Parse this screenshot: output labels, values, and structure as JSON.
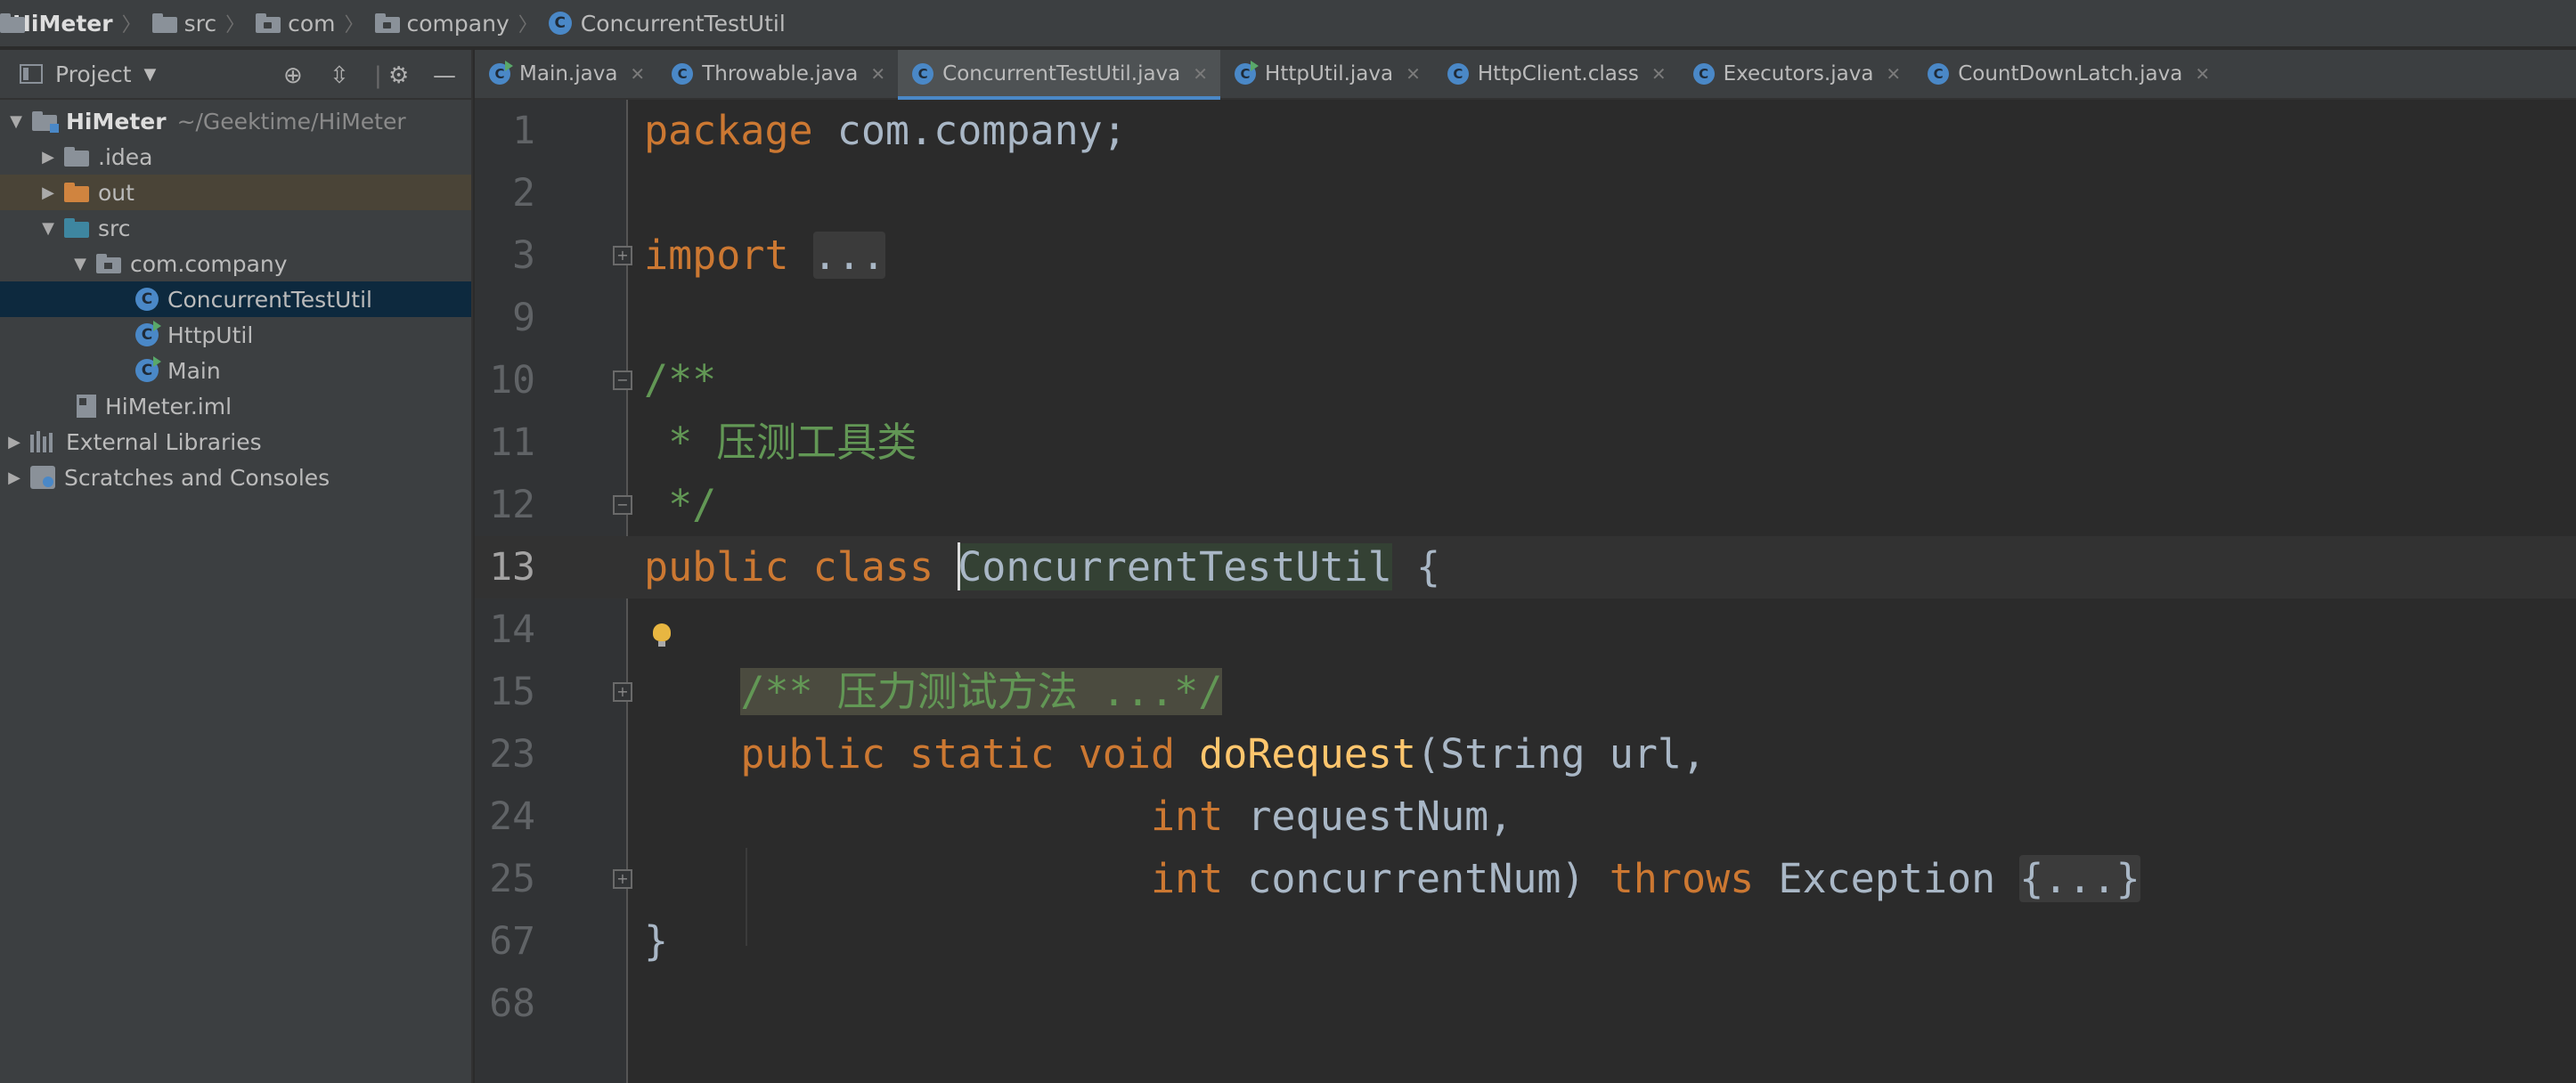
{
  "breadcrumb": {
    "items": [
      "HiMeter",
      "src",
      "com",
      "company",
      "ConcurrentTestUtil"
    ]
  },
  "project_panel": {
    "title": "Project",
    "tree": [
      {
        "label": "HiMeter",
        "path": "~/Geektime/HiMeter"
      },
      {
        "label": ".idea"
      },
      {
        "label": "out"
      },
      {
        "label": "src"
      },
      {
        "label": "com.company"
      },
      {
        "label": "ConcurrentTestUtil"
      },
      {
        "label": "HttpUtil"
      },
      {
        "label": "Main"
      },
      {
        "label": "HiMeter.iml"
      },
      {
        "label": "External Libraries"
      },
      {
        "label": "Scratches and Consoles"
      }
    ]
  },
  "tabs": [
    {
      "label": "Main.java"
    },
    {
      "label": "Throwable.java"
    },
    {
      "label": "ConcurrentTestUtil.java",
      "active": true
    },
    {
      "label": "HttpUtil.java"
    },
    {
      "label": "HttpClient.class"
    },
    {
      "label": "Executors.java"
    },
    {
      "label": "CountDownLatch.java"
    }
  ],
  "editor": {
    "line_numbers": [
      "1",
      "2",
      "3",
      "9",
      "10",
      "11",
      "12",
      "13",
      "14",
      "15",
      "23",
      "24",
      "25",
      "67",
      "68"
    ],
    "code": {
      "l1_kw": "package",
      "l1_rest": " com.company;",
      "l3_kw": "import",
      "l3_fold": "...",
      "l10": "/**",
      "l11": " * 压测工具类",
      "l12": " */",
      "l13_kw": "public class ",
      "l13_cls": "ConcurrentTestUtil",
      "l13_rest": " {",
      "l15_doc": "/** 压力测试方法 ...*/",
      "l23_kw": "public static void ",
      "l23_fn": "doRequest",
      "l23_rest": "(String url,",
      "l24_kw": "int",
      "l24_rest": " requestNum,",
      "l25_kw": "int",
      "l25_mid": " concurrentNum) ",
      "l25_kw2": "throws",
      "l25_rest": " Exception ",
      "l25_fold": "{...}",
      "l67": "}"
    }
  },
  "colors": {
    "keyword": "#cc7832",
    "function": "#ffc66d",
    "doc_comment": "#629755",
    "text": "#a9b7c6",
    "background": "#2b2b2b"
  }
}
